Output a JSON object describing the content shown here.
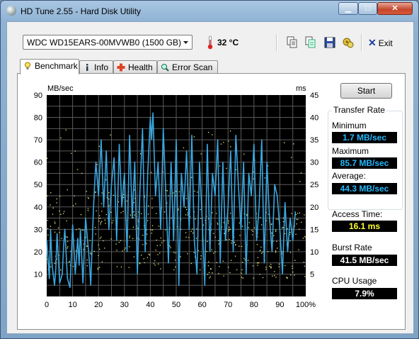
{
  "window": {
    "title": "HD Tune 2.55 - Hard Disk Utility"
  },
  "toolbar": {
    "drive": "WDC WD15EARS-00MVWB0 (1500 GB)",
    "temperature": "32 °C",
    "exit_label": "Exit"
  },
  "tabs": [
    {
      "label": "Benchmark",
      "icon": "lightbulb-icon"
    },
    {
      "label": "Info",
      "icon": "info-icon"
    },
    {
      "label": "Health",
      "icon": "health-cross-icon"
    },
    {
      "label": "Error Scan",
      "icon": "magnifier-icon"
    }
  ],
  "controls": {
    "start_label": "Start"
  },
  "stats": {
    "transfer_rate_title": "Transfer Rate",
    "minimum_label": "Minimum",
    "minimum_value": "1.7 MB/sec",
    "maximum_label": "Maximum",
    "maximum_value": "85.7 MB/sec",
    "average_label": "Average:",
    "average_value": "44.3 MB/sec",
    "access_label": "Access Time:",
    "access_value": "16.1 ms",
    "burst_label": "Burst Rate",
    "burst_value": "41.5 MB/sec",
    "cpu_label": "CPU Usage",
    "cpu_value": "7.9%"
  },
  "colors": {
    "transfer_line": "#3aa7e0",
    "access_dots": "#f4f07a",
    "plot_bg": "#000000",
    "grid": "#5a5a5a"
  },
  "chart_data": {
    "type": "line",
    "left_unit": "MB/sec",
    "right_unit": "ms",
    "x_ticks": [
      "0",
      "10",
      "20",
      "30",
      "40",
      "50",
      "60",
      "70",
      "80",
      "90",
      "100%"
    ],
    "y_left_ticks": [
      "10",
      "20",
      "30",
      "40",
      "50",
      "60",
      "70",
      "80",
      "90"
    ],
    "y_right_ticks": [
      "5",
      "10",
      "15",
      "20",
      "25",
      "30",
      "35",
      "40",
      "45"
    ],
    "xlim": [
      0,
      100
    ],
    "ylim_left": [
      0,
      90
    ],
    "ylim_right": [
      0,
      45
    ],
    "series": [
      {
        "values_x": [
          0,
          1,
          1.5,
          2,
          3,
          3.5,
          4,
          5,
          6,
          6.5,
          7,
          8,
          9,
          9.5,
          10,
          11,
          12,
          12.5,
          13,
          14,
          15,
          16,
          16.5,
          17,
          18,
          18.5,
          19,
          20,
          21,
          22,
          23,
          24,
          25,
          26,
          27,
          28,
          29,
          30,
          31,
          32,
          33,
          34,
          35,
          36,
          37,
          38,
          39,
          40,
          40.5,
          41,
          42,
          43,
          44,
          45,
          46,
          47,
          48,
          49,
          50,
          51,
          52,
          53,
          54,
          55,
          56,
          57,
          58,
          59,
          60,
          61,
          62,
          63,
          64,
          65,
          66,
          67,
          68,
          69,
          70,
          71,
          72,
          73,
          74,
          75,
          76,
          77,
          78,
          79,
          80,
          81,
          82,
          83,
          84,
          85,
          86,
          87,
          88,
          89,
          90,
          91,
          92,
          93,
          94,
          95,
          96,
          97,
          98,
          99,
          100
        ],
        "values_y": [
          25,
          8,
          30,
          15,
          5,
          12,
          28,
          6,
          10,
          22,
          30,
          8,
          4,
          18,
          32,
          10,
          26,
          14,
          30,
          6,
          35,
          22,
          15,
          5,
          38,
          50,
          60,
          45,
          70,
          40,
          65,
          30,
          50,
          62,
          25,
          68,
          40,
          55,
          20,
          72,
          35,
          60,
          10,
          48,
          75,
          20,
          55,
          80,
          70,
          82,
          45,
          60,
          30,
          75,
          45,
          15,
          60,
          25,
          70,
          5,
          55,
          40,
          65,
          30,
          72,
          25,
          10,
          60,
          35,
          5,
          68,
          20,
          55,
          45,
          70,
          15,
          60,
          25,
          40,
          65,
          20,
          72,
          50,
          30,
          60,
          10,
          55,
          45,
          68,
          25,
          40,
          70,
          15,
          60,
          35,
          20,
          50,
          45,
          30,
          10,
          42,
          20,
          35,
          25,
          38
        ]
      }
    ]
  }
}
